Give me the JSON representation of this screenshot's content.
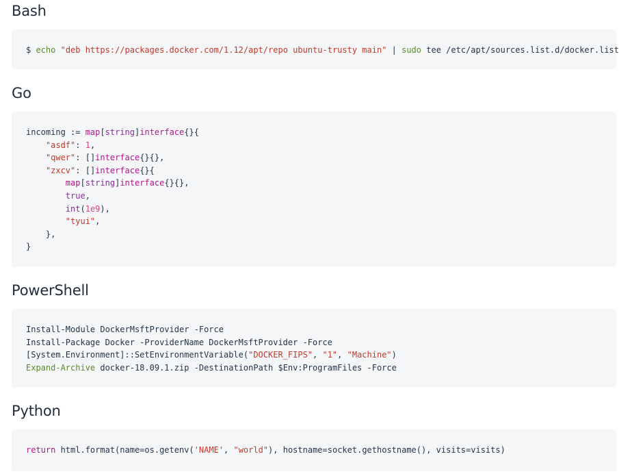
{
  "sections": [
    {
      "title": "Bash",
      "lines": [
        [
          {
            "t": "$ ",
            "c": "prompt"
          },
          {
            "t": "echo",
            "c": "cmd"
          },
          {
            "t": " ",
            "c": "plain"
          },
          {
            "t": "\"deb https://packages.docker.com/1.12/apt/repo ubuntu-trusty main\"",
            "c": "str"
          },
          {
            "t": " | ",
            "c": "plain"
          },
          {
            "t": "sudo",
            "c": "cmd"
          },
          {
            "t": " tee /etc/apt/sources.list.d/docker.list",
            "c": "plain"
          }
        ]
      ]
    },
    {
      "title": "Go",
      "lines": [
        [
          {
            "t": "incoming := ",
            "c": "plain"
          },
          {
            "t": "map",
            "c": "kw2"
          },
          {
            "t": "[",
            "c": "plain"
          },
          {
            "t": "string",
            "c": "kw"
          },
          {
            "t": "]",
            "c": "plain"
          },
          {
            "t": "interface",
            "c": "kw2"
          },
          {
            "t": "{}{",
            "c": "plain"
          }
        ],
        [
          {
            "t": "    ",
            "c": "plain"
          },
          {
            "t": "\"asdf\"",
            "c": "str"
          },
          {
            "t": ": ",
            "c": "plain"
          },
          {
            "t": "1",
            "c": "num"
          },
          {
            "t": ",",
            "c": "plain"
          }
        ],
        [
          {
            "t": "    ",
            "c": "plain"
          },
          {
            "t": "\"qwer\"",
            "c": "str"
          },
          {
            "t": ": []",
            "c": "plain"
          },
          {
            "t": "interface",
            "c": "kw2"
          },
          {
            "t": "{}{},",
            "c": "plain"
          }
        ],
        [
          {
            "t": "    ",
            "c": "plain"
          },
          {
            "t": "\"zxcv\"",
            "c": "str"
          },
          {
            "t": ": []",
            "c": "plain"
          },
          {
            "t": "interface",
            "c": "kw2"
          },
          {
            "t": "{}{",
            "c": "plain"
          }
        ],
        [
          {
            "t": "        ",
            "c": "plain"
          },
          {
            "t": "map",
            "c": "kw2"
          },
          {
            "t": "[",
            "c": "plain"
          },
          {
            "t": "string",
            "c": "kw"
          },
          {
            "t": "]",
            "c": "plain"
          },
          {
            "t": "interface",
            "c": "kw2"
          },
          {
            "t": "{}{},",
            "c": "plain"
          }
        ],
        [
          {
            "t": "        ",
            "c": "plain"
          },
          {
            "t": "true",
            "c": "kw"
          },
          {
            "t": ",",
            "c": "plain"
          }
        ],
        [
          {
            "t": "        ",
            "c": "plain"
          },
          {
            "t": "int",
            "c": "kw"
          },
          {
            "t": "(",
            "c": "plain"
          },
          {
            "t": "1e9",
            "c": "num"
          },
          {
            "t": "),",
            "c": "plain"
          }
        ],
        [
          {
            "t": "        ",
            "c": "plain"
          },
          {
            "t": "\"tyui\"",
            "c": "str"
          },
          {
            "t": ",",
            "c": "plain"
          }
        ],
        [
          {
            "t": "    },",
            "c": "plain"
          }
        ],
        [
          {
            "t": "}",
            "c": "plain"
          }
        ]
      ]
    },
    {
      "title": "PowerShell",
      "lines": [
        [
          {
            "t": "Install-Module DockerMsftProvider -Force",
            "c": "plain"
          }
        ],
        [
          {
            "t": "Install-Package Docker -ProviderName DockerMsftProvider -Force",
            "c": "plain"
          }
        ],
        [
          {
            "t": "[System.Environment]::SetEnvironmentVariable(",
            "c": "plain"
          },
          {
            "t": "\"DOCKER_FIPS\"",
            "c": "str"
          },
          {
            "t": ", ",
            "c": "plain"
          },
          {
            "t": "\"1\"",
            "c": "str"
          },
          {
            "t": ", ",
            "c": "plain"
          },
          {
            "t": "\"Machine\"",
            "c": "str"
          },
          {
            "t": ")",
            "c": "plain"
          }
        ],
        [
          {
            "t": "Expand-Archive",
            "c": "cmd"
          },
          {
            "t": " docker-18.09.1.zip -DestinationPath $Env:ProgramFiles -Force",
            "c": "plain"
          }
        ]
      ]
    },
    {
      "title": "Python",
      "lines": [
        [
          {
            "t": "return",
            "c": "kw2"
          },
          {
            "t": " html.format(name=os.getenv(",
            "c": "plain"
          },
          {
            "t": "'NAME'",
            "c": "str"
          },
          {
            "t": ", ",
            "c": "plain"
          },
          {
            "t": "\"world\"",
            "c": "str"
          },
          {
            "t": "), hostname=socket.gethostname(), visits=visits)",
            "c": "plain"
          }
        ]
      ]
    }
  ],
  "colors": {
    "code_background": "#f4f6f8",
    "heading": "#1f2d3d",
    "plain": "#253447",
    "command": "#5a8a2a",
    "string": "#c0392b",
    "keyword": "#8a2a9a",
    "number": "#d1457a"
  }
}
